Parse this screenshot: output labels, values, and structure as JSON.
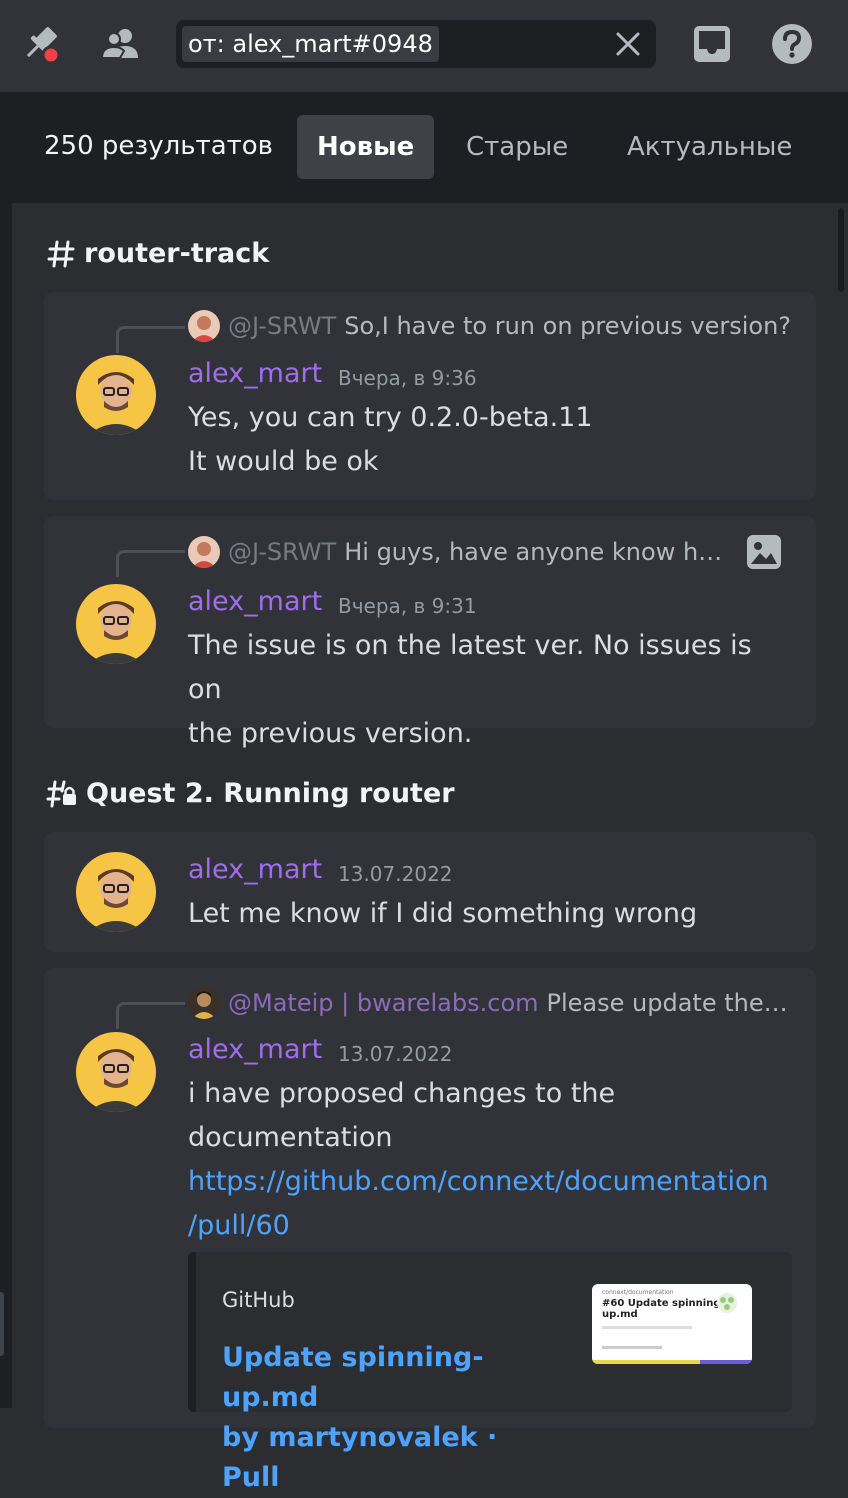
{
  "search": {
    "query": "от:  alex_mart#0948"
  },
  "results": {
    "count": "250 результатов",
    "tabs": [
      "Новые",
      "Старые",
      "Актуальные"
    ],
    "active_tab": "Новые"
  },
  "channels": [
    {
      "name": "router-track",
      "icon": "hash-icon",
      "messages": [
        {
          "reply": {
            "mention": "@J-SRWT",
            "text": "So,I have to run on previous version?"
          },
          "author": "alex_mart",
          "time": "Вчера, в 9:36",
          "lines": [
            "Yes, you can try 0.2.0-beta.11",
            "It would be ok"
          ]
        },
        {
          "reply": {
            "mention": "@J-SRWT",
            "text": "Hi guys, have anyone know ho…",
            "attachment_icon": "image-icon"
          },
          "author": "alex_mart",
          "time": "Вчера, в 9:31",
          "lines": [
            "The issue is on the latest ver. No issues is on",
            "the previous version."
          ]
        }
      ]
    },
    {
      "name": "Quest 2. Running router",
      "icon": "locked-thread-icon",
      "messages": [
        {
          "author": "alex_mart",
          "time": "13.07.2022",
          "lines": [
            "Let me know if I did something wrong"
          ]
        },
        {
          "reply": {
            "mention": "@Mateip | bwarelabs.com",
            "text": "Please update the r…"
          },
          "author": "alex_mart",
          "time": "13.07.2022",
          "lines": [
            "i have proposed changes to the",
            "documentation"
          ],
          "link": [
            "https://github.com/connext/documentation",
            "/pull/60"
          ],
          "embed": {
            "provider": "GitHub",
            "title_lines": [
              "Update spinning-up.md",
              "by martynovalek · Pull"
            ],
            "thumb_repo": "connext/documentation",
            "thumb_title": [
              "#60 Update spinning-",
              "up.md"
            ]
          }
        }
      ]
    }
  ],
  "colors": {
    "background": "#2b2d31",
    "card": "#313338",
    "author": "#a06cf0",
    "link": "#4ea3ff",
    "timestamp": "#949ba4"
  }
}
